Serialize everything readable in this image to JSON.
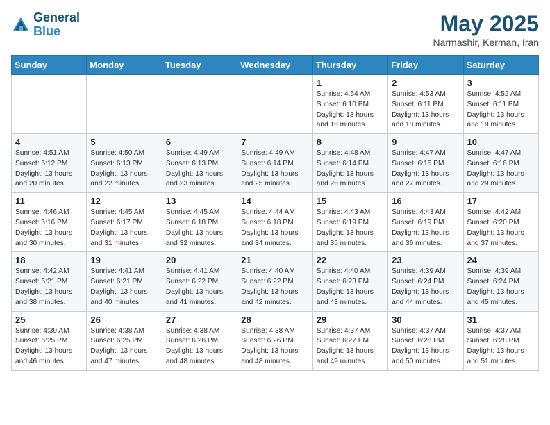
{
  "header": {
    "logo_line1": "General",
    "logo_line2": "Blue",
    "month": "May 2025",
    "location": "Narmashir, Kerman, Iran"
  },
  "days_of_week": [
    "Sunday",
    "Monday",
    "Tuesday",
    "Wednesday",
    "Thursday",
    "Friday",
    "Saturday"
  ],
  "weeks": [
    [
      {
        "num": "",
        "detail": ""
      },
      {
        "num": "",
        "detail": ""
      },
      {
        "num": "",
        "detail": ""
      },
      {
        "num": "",
        "detail": ""
      },
      {
        "num": "1",
        "detail": "Sunrise: 4:54 AM\nSunset: 6:10 PM\nDaylight: 13 hours\nand 16 minutes."
      },
      {
        "num": "2",
        "detail": "Sunrise: 4:53 AM\nSunset: 6:11 PM\nDaylight: 13 hours\nand 18 minutes."
      },
      {
        "num": "3",
        "detail": "Sunrise: 4:52 AM\nSunset: 6:11 PM\nDaylight: 13 hours\nand 19 minutes."
      }
    ],
    [
      {
        "num": "4",
        "detail": "Sunrise: 4:51 AM\nSunset: 6:12 PM\nDaylight: 13 hours\nand 20 minutes."
      },
      {
        "num": "5",
        "detail": "Sunrise: 4:50 AM\nSunset: 6:13 PM\nDaylight: 13 hours\nand 22 minutes."
      },
      {
        "num": "6",
        "detail": "Sunrise: 4:49 AM\nSunset: 6:13 PM\nDaylight: 13 hours\nand 23 minutes."
      },
      {
        "num": "7",
        "detail": "Sunrise: 4:49 AM\nSunset: 6:14 PM\nDaylight: 13 hours\nand 25 minutes."
      },
      {
        "num": "8",
        "detail": "Sunrise: 4:48 AM\nSunset: 6:14 PM\nDaylight: 13 hours\nand 26 minutes."
      },
      {
        "num": "9",
        "detail": "Sunrise: 4:47 AM\nSunset: 6:15 PM\nDaylight: 13 hours\nand 27 minutes."
      },
      {
        "num": "10",
        "detail": "Sunrise: 4:47 AM\nSunset: 6:16 PM\nDaylight: 13 hours\nand 29 minutes."
      }
    ],
    [
      {
        "num": "11",
        "detail": "Sunrise: 4:46 AM\nSunset: 6:16 PM\nDaylight: 13 hours\nand 30 minutes."
      },
      {
        "num": "12",
        "detail": "Sunrise: 4:45 AM\nSunset: 6:17 PM\nDaylight: 13 hours\nand 31 minutes."
      },
      {
        "num": "13",
        "detail": "Sunrise: 4:45 AM\nSunset: 6:18 PM\nDaylight: 13 hours\nand 32 minutes."
      },
      {
        "num": "14",
        "detail": "Sunrise: 4:44 AM\nSunset: 6:18 PM\nDaylight: 13 hours\nand 34 minutes."
      },
      {
        "num": "15",
        "detail": "Sunrise: 4:43 AM\nSunset: 6:19 PM\nDaylight: 13 hours\nand 35 minutes."
      },
      {
        "num": "16",
        "detail": "Sunrise: 4:43 AM\nSunset: 6:19 PM\nDaylight: 13 hours\nand 36 minutes."
      },
      {
        "num": "17",
        "detail": "Sunrise: 4:42 AM\nSunset: 6:20 PM\nDaylight: 13 hours\nand 37 minutes."
      }
    ],
    [
      {
        "num": "18",
        "detail": "Sunrise: 4:42 AM\nSunset: 6:21 PM\nDaylight: 13 hours\nand 38 minutes."
      },
      {
        "num": "19",
        "detail": "Sunrise: 4:41 AM\nSunset: 6:21 PM\nDaylight: 13 hours\nand 40 minutes."
      },
      {
        "num": "20",
        "detail": "Sunrise: 4:41 AM\nSunset: 6:22 PM\nDaylight: 13 hours\nand 41 minutes."
      },
      {
        "num": "21",
        "detail": "Sunrise: 4:40 AM\nSunset: 6:22 PM\nDaylight: 13 hours\nand 42 minutes."
      },
      {
        "num": "22",
        "detail": "Sunrise: 4:40 AM\nSunset: 6:23 PM\nDaylight: 13 hours\nand 43 minutes."
      },
      {
        "num": "23",
        "detail": "Sunrise: 4:39 AM\nSunset: 6:24 PM\nDaylight: 13 hours\nand 44 minutes."
      },
      {
        "num": "24",
        "detail": "Sunrise: 4:39 AM\nSunset: 6:24 PM\nDaylight: 13 hours\nand 45 minutes."
      }
    ],
    [
      {
        "num": "25",
        "detail": "Sunrise: 4:39 AM\nSunset: 6:25 PM\nDaylight: 13 hours\nand 46 minutes."
      },
      {
        "num": "26",
        "detail": "Sunrise: 4:38 AM\nSunset: 6:25 PM\nDaylight: 13 hours\nand 47 minutes."
      },
      {
        "num": "27",
        "detail": "Sunrise: 4:38 AM\nSunset: 6:26 PM\nDaylight: 13 hours\nand 48 minutes."
      },
      {
        "num": "28",
        "detail": "Sunrise: 4:38 AM\nSunset: 6:26 PM\nDaylight: 13 hours\nand 48 minutes."
      },
      {
        "num": "29",
        "detail": "Sunrise: 4:37 AM\nSunset: 6:27 PM\nDaylight: 13 hours\nand 49 minutes."
      },
      {
        "num": "30",
        "detail": "Sunrise: 4:37 AM\nSunset: 6:28 PM\nDaylight: 13 hours\nand 50 minutes."
      },
      {
        "num": "31",
        "detail": "Sunrise: 4:37 AM\nSunset: 6:28 PM\nDaylight: 13 hours\nand 51 minutes."
      }
    ]
  ]
}
